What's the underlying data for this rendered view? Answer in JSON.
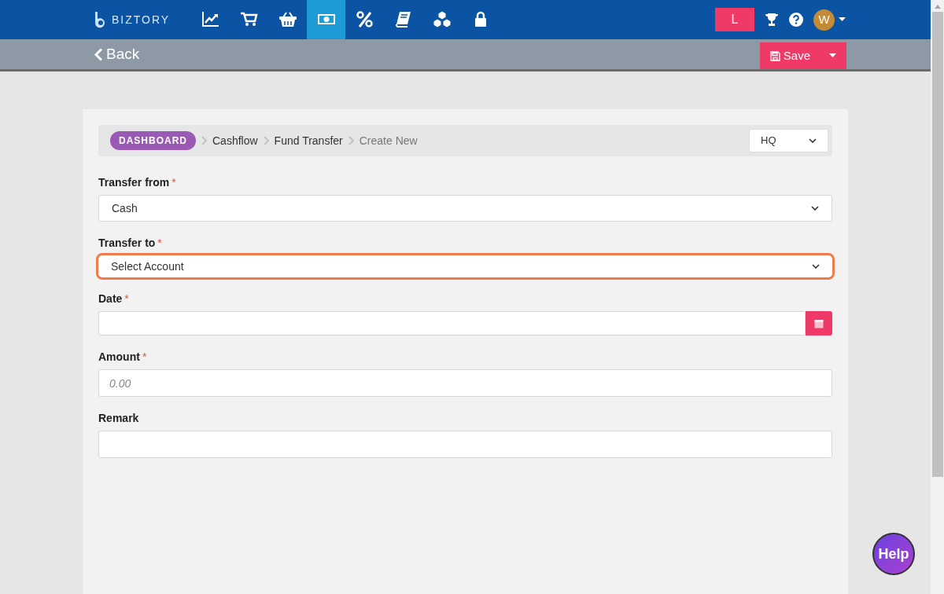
{
  "brand": {
    "name": "BIZTORY"
  },
  "nav": [
    {
      "kind": "chart",
      "selected": false
    },
    {
      "kind": "cart",
      "selected": false
    },
    {
      "kind": "basket",
      "selected": false
    },
    {
      "kind": "money",
      "selected": true
    },
    {
      "kind": "percent",
      "selected": false
    },
    {
      "kind": "book",
      "selected": false
    },
    {
      "kind": "boxes",
      "selected": false
    },
    {
      "kind": "lock",
      "selected": false
    }
  ],
  "user_menu": {
    "badge": "L",
    "avatar": "W"
  },
  "toolbar": {
    "back": "Back",
    "save": "Save"
  },
  "breadcrumb": [
    {
      "label": "DASHBOARD",
      "kind": "pill"
    },
    {
      "label": "Cashflow",
      "kind": "link"
    },
    {
      "label": "Fund Transfer",
      "kind": "link"
    },
    {
      "label": "Create New",
      "kind": "current"
    }
  ],
  "branch_select": {
    "value": "HQ"
  },
  "fields": [
    {
      "label": "Transfer from",
      "required_mark": "*",
      "kind": "select",
      "value": "Cash",
      "focused": false
    },
    {
      "label": "Transfer to",
      "required_mark": "*",
      "kind": "select",
      "value": "Select Account",
      "focused": true
    },
    {
      "label": "Date",
      "required_mark": "*",
      "kind": "date",
      "focused": false
    },
    {
      "label": "Amount",
      "required_mark": "*",
      "kind": "text",
      "placeholder": "0.00",
      "focused": false
    },
    {
      "label": "Remark",
      "kind": "text",
      "focused": false
    }
  ],
  "help_button": "Help"
}
